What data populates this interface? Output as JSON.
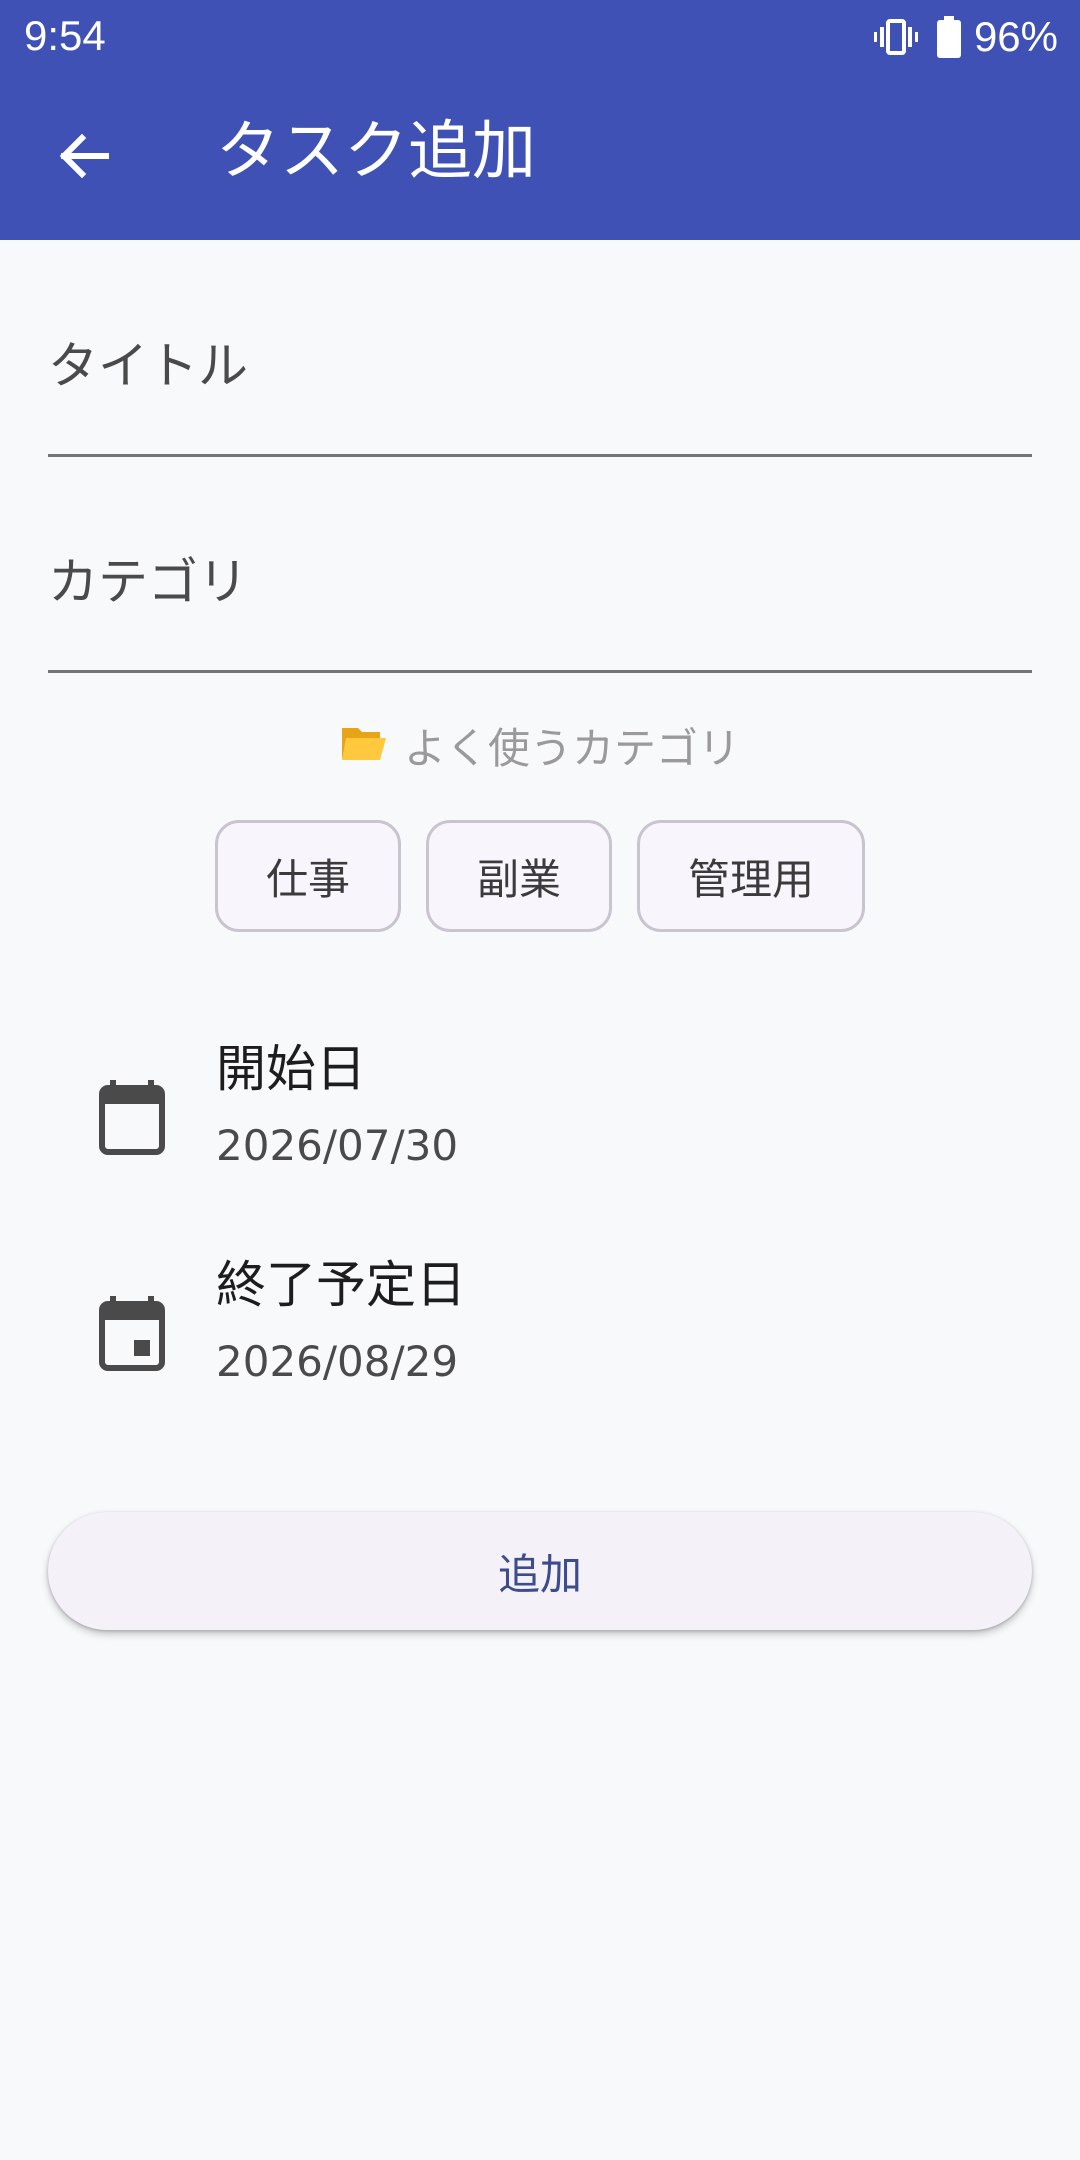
{
  "status_bar": {
    "time": "9:54",
    "battery_percent": "96%",
    "icons": [
      "vibrate-icon",
      "battery-icon"
    ]
  },
  "app_bar": {
    "title": "タスク追加",
    "back_icon": "arrow-back-icon",
    "color": "#3f51b5"
  },
  "form": {
    "title_field": {
      "placeholder": "タイトル",
      "value": ""
    },
    "category_field": {
      "placeholder": "カテゴリ",
      "value": ""
    },
    "frequent_categories": {
      "label": "よく使うカテゴリ",
      "icon": "folder-icon",
      "chips": [
        "仕事",
        "副業",
        "管理用"
      ]
    },
    "start_date": {
      "label": "開始日",
      "value": "2026/07/30",
      "icon": "calendar-icon"
    },
    "end_date": {
      "label": "終了予定日",
      "value": "2026/08/29",
      "icon": "event-icon"
    },
    "submit_label": "追加"
  }
}
